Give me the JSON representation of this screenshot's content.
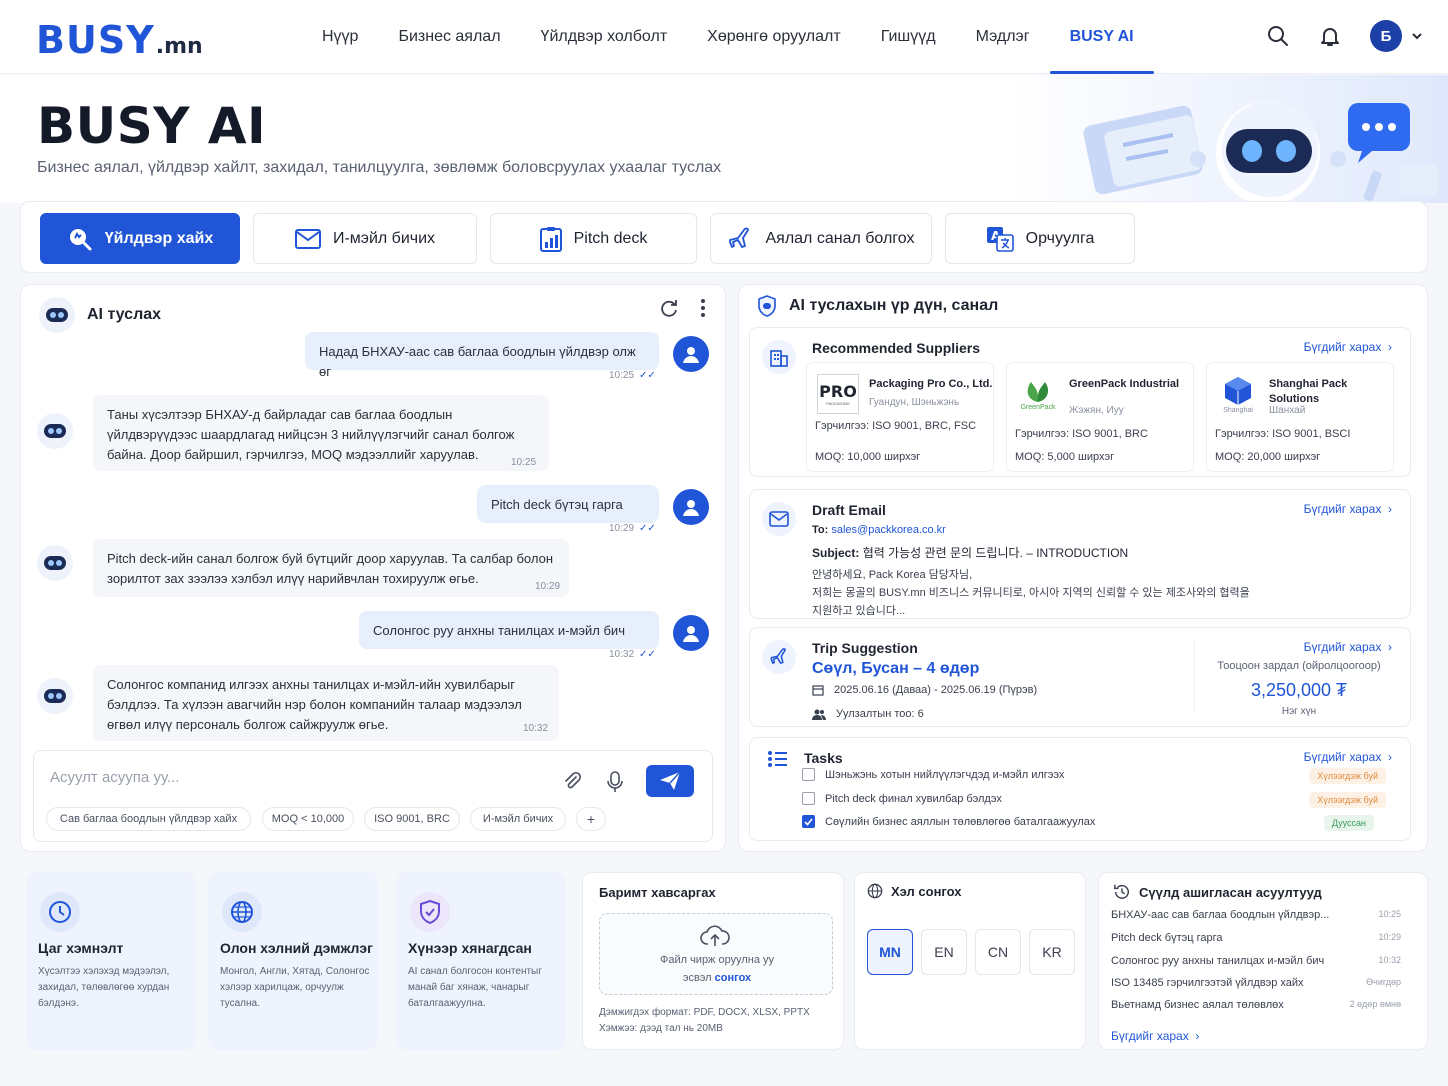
{
  "nav": {
    "logo_main": "BUSY",
    "logo_suffix": ".mn",
    "items": [
      "Нүүр",
      "Бизнес аялал",
      "Үйлдвэр холболт",
      "Хөрөнгө оруулалт",
      "Гишүүд",
      "Мэдлэг",
      "BUSY AI"
    ],
    "active_item": "BUSY AI",
    "avatar_letter": "Б"
  },
  "hero": {
    "title": "BUSY AI",
    "subtitle": "Бизнес аялал, үйлдвэр хайлт, захидал, танилцуулга, зөвлөмж боловсруулах ухаалаг туслах"
  },
  "tabs": [
    {
      "label": "Үйлдвэр хайх",
      "icon": "search-factory-icon",
      "active": true
    },
    {
      "label": "И-мэйл бичих",
      "icon": "mail-icon",
      "active": false
    },
    {
      "label": "Pitch deck",
      "icon": "chart-doc-icon",
      "active": false
    },
    {
      "label": "Аялал санал болгох",
      "icon": "plane-icon",
      "active": false
    },
    {
      "label": "Орчуулга",
      "icon": "translate-icon",
      "active": false
    }
  ],
  "chat": {
    "title": "AI туслах",
    "messages": [
      {
        "role": "user",
        "text": "Надад БНХАУ-аас сав баглаа боодлын үйлдвэр олж өг",
        "time": "10:25"
      },
      {
        "role": "ai",
        "text": "Таны хүсэлтээр БНХАУ-д байрладаг сав баглаа боодлын үйлдвэрүүдээс шаардлагад нийцсэн 3 нийлүүлэгчийг санал болгож байна. Доор байршил, гэрчилгээ, MOQ мэдээллийг харуулав.",
        "time": "10:25"
      },
      {
        "role": "user",
        "text": "Pitch deck бүтэц гарга",
        "time": "10:29"
      },
      {
        "role": "ai",
        "text": "Pitch deck-ийн санал болгож буй бүтцийг доор харуулав. Та салбар болон зорилтот зах зээлээ хэлбэл илүү нарийвчлан тохируулж өгье.",
        "time": "10:29"
      },
      {
        "role": "user",
        "text": "Солонгос руу анхны танилцах и-мэйл бич",
        "time": "10:32"
      },
      {
        "role": "ai",
        "text": "Солонгос компанид илгээх анхны танилцах и-мэйл-ийн хувилбарыг бэлдлээ. Та хүлээн авагчийн нэр болон компанийн талаар мэдээлэл өгвөл илүү персональ болгож сайжруулж өгье.",
        "time": "10:32"
      }
    ],
    "input_placeholder": "Асуулт асуупа уу...",
    "chips": [
      "Сав баглаа боодлын үйлдвэр хайх",
      "MOQ < 10,000",
      "ISO 9001, BRC",
      "И-мэйл бичих",
      "+"
    ]
  },
  "results": {
    "title": "AI туслахын үр дүн, санал",
    "more_label": "Бүгдийг харах",
    "suppliers": {
      "title": "Recommended Suppliers",
      "items": [
        {
          "logo": "PRO",
          "logo_sub": "PACKAGING",
          "name": "Packaging Pro Co., Ltd.",
          "location": "Гуандун, Шэньжэнь",
          "cert_label": "Гэрчилгээ:",
          "cert": "ISO 9001, BRC, FSC",
          "moq_label": "MOQ:",
          "moq": "10,000 ширхэг"
        },
        {
          "logo": "GreenPack",
          "name": "GreenPack Industrial",
          "location": "Жэжян, Иуу",
          "cert_label": "Гэрчилгээ:",
          "cert": "ISO 9001, BRC",
          "moq_label": "MOQ:",
          "moq": "5,000 ширхэг"
        },
        {
          "logo": "Shanghai",
          "name": "Shanghai Pack Solutions",
          "location": "Шанхай",
          "cert_label": "Гэрчилгээ:",
          "cert": "ISO 9001, BSCI",
          "moq_label": "MOQ:",
          "moq": "20,000 ширхэг"
        }
      ]
    },
    "email": {
      "title": "Draft Email",
      "to_label": "To:",
      "to": "sales@packkorea.co.kr",
      "subject_label": "Subject:",
      "subject": "협력 가능성 관련 문의 드립니다. – INTRODUCTION",
      "body1": "안녕하세요, Pack Korea 담당자님,",
      "body2": "저희는 몽골의 BUSY.mn 비즈니스 커뮤니티로, 아시아 지역의 신뢰할 수 있는 제조사와의 협력을",
      "body3": "지원하고 있습니다..."
    },
    "trip": {
      "title": "Trip Suggestion",
      "route": "Сөүл, Бусан – 4 өдөр",
      "dates": "2025.06.16 (Даваа) - 2025.06.19 (Пүрэв)",
      "travelers": "Уулзалтын тоо: 6",
      "cost_label": "Тооцоон зардал (ойролцоогоор)",
      "cost": "3,250,000 ₮",
      "cost_unit": "Нэг хүн"
    },
    "tasks": {
      "title": "Tasks",
      "items": [
        {
          "text": "Шэньжэнь хотын нийлүүлэгчдэд и-мэйл илгээх",
          "done": false,
          "status": "Хүлээгдэж буй"
        },
        {
          "text": "Pitch deck финал хувилбар бэлдэх",
          "done": false,
          "status": "Хүлээгдэж буй"
        },
        {
          "text": "Сөүлийн бизнес аяллын төлөвлөгөө баталгаажуулах",
          "done": true,
          "status": "Дууссан"
        }
      ]
    }
  },
  "features": [
    {
      "title": "Цаг хэмнэлт",
      "desc": "Хүсэлтээ хэлэхэд мэдээлэл, захидал, төлөвлөгөө хурдан бэлдэнэ.",
      "icon": "clock-icon"
    },
    {
      "title": "Олон хэлний дэмжлэг",
      "desc": "Монгол, Англи, Хятад, Солонгос хэлээр харилцаж, орчуулж тусална.",
      "icon": "globe-icon"
    },
    {
      "title": "Хүнээр хянагдсан",
      "desc": "AI санал болгосон контентыг манай баг хянаж, чанарыг баталгаажуулна.",
      "icon": "shield-check-icon"
    }
  ],
  "upload": {
    "title": "Баримт хавсаргах",
    "drop_text": "Файл чирж оруулна уу",
    "or_text": "эсвэл",
    "choose": "сонгох",
    "formats": "Дэмжигдэх формат: PDF, DOCX, XLSX, PPTX",
    "size": "Хэмжээ: дээд тал нь 20MB"
  },
  "language": {
    "title": "Хэл сонгох",
    "options": [
      "MN",
      "EN",
      "CN",
      "KR"
    ],
    "selected": "MN"
  },
  "recent": {
    "title": "Сүүлд ашигласан асуултууд",
    "items": [
      {
        "q": "БНХАУ-аас сав баглаа боодлын үйлдвэр...",
        "t": "10:25"
      },
      {
        "q": "Pitch deck бүтэц гарга",
        "t": "10:29"
      },
      {
        "q": "Солонгос руу анхны танилцах и-мэйл бич",
        "t": "10:32"
      },
      {
        "q": "ISO 13485 гэрчилгээтэй үйлдвэр хайх",
        "t": "Өчигдөр"
      },
      {
        "q": "Вьетнамд бизнес аялал төлөвлөх",
        "t": "2 өдөр өмнө"
      }
    ],
    "more": "Бүгдийг харах"
  },
  "colors": {
    "accent": "#1f55d6",
    "pending": "#e08a3c",
    "done": "#3f9a5c"
  }
}
